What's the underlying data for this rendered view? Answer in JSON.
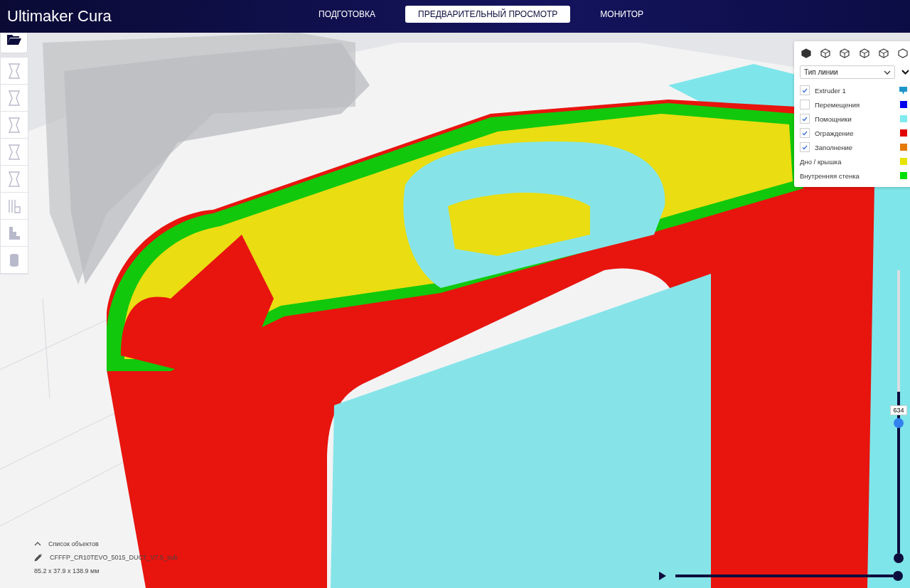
{
  "header": {
    "logo": "**Ultimaker** Cura",
    "tabs": [
      {
        "label": "ПОДГОТОВКА",
        "selected": false
      },
      {
        "label": "ПРЕДВАРИТЕЛЬНЫЙ ПРОСМОТР",
        "selected": true
      },
      {
        "label": "МОНИТОР",
        "selected": false
      }
    ]
  },
  "legend": {
    "view_type": "Тип линии",
    "items": [
      {
        "kind": "extruder",
        "label": "Extruder 1",
        "checked": true,
        "color": "#1e96c8"
      },
      {
        "kind": "checkbox",
        "label": "Перемещения",
        "checked": false,
        "color": "#0000f0"
      },
      {
        "kind": "checkbox",
        "label": "Помощники",
        "checked": true,
        "color": "#80eaf0"
      },
      {
        "kind": "checkbox",
        "label": "Ограждение",
        "checked": true,
        "color": "#e00000"
      },
      {
        "kind": "checkbox",
        "label": "Заполнение",
        "checked": true,
        "color": "#e47a00"
      },
      {
        "kind": "plain",
        "label": "Дно / крышка",
        "color": "#e8e400"
      },
      {
        "kind": "plain",
        "label": "Внутренняя стенка",
        "color": "#00e000"
      }
    ]
  },
  "object_info": {
    "list_label": "Список объектов",
    "filename": "CFFFP_CR10TEVO_5015_DUCT_V7.5_sub",
    "dimensions": "85.2 x 37.9 x 138.9 мм"
  },
  "layer_slider": {
    "value": "634",
    "level": 0.57
  },
  "path_slider": {
    "level": 1
  }
}
